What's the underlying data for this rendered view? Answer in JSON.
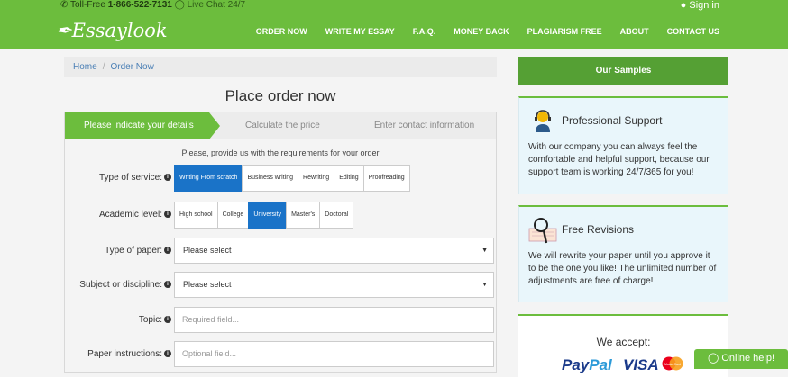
{
  "header": {
    "toll_free_label": "Toll-Free",
    "phone": "1-866-522-7131",
    "live_chat": "Live Chat 24/7",
    "sign_in": "Sign in",
    "logo": "Essaylook",
    "nav": [
      "ORDER NOW",
      "WRITE MY ESSAY",
      "F.A.Q.",
      "MONEY BACK",
      "PLAGIARISM FREE",
      "ABOUT",
      "CONTACT US"
    ]
  },
  "breadcrumb": {
    "home": "Home",
    "separator": "/",
    "current": "Order Now"
  },
  "page_title": "Place order now",
  "steps": [
    "Please indicate your details",
    "Calculate the price",
    "Enter contact information"
  ],
  "intro": "Please, provide us with the requirements for your order",
  "form": {
    "service": {
      "label": "Type of service:",
      "options": [
        "Writing From scratch",
        "Business writing",
        "Rewriting",
        "Editing",
        "Proofreading"
      ],
      "selected": "Writing From scratch"
    },
    "level": {
      "label": "Academic level:",
      "options": [
        "High school",
        "College",
        "University",
        "Master's",
        "Doctoral"
      ],
      "selected": "University"
    },
    "paper_type": {
      "label": "Type of paper:",
      "value": "Please select"
    },
    "subject": {
      "label": "Subject or discipline:",
      "value": "Please select"
    },
    "topic": {
      "label": "Topic:",
      "placeholder": "Required field..."
    },
    "instructions": {
      "label": "Paper instructions:",
      "placeholder": "Optional field..."
    }
  },
  "sidebar": {
    "samples": "Our Samples",
    "support": {
      "title": "Professional Support",
      "text": "With our company you can always feel the comfortable and helpful support, because our support team is working 24/7/365 for you!"
    },
    "revisions": {
      "title": "Free Revisions",
      "text": "We will rewrite your paper until you approve it to be the one you like! The unlimited number of adjustments are free of charge!"
    },
    "accept": {
      "title": "We accept:",
      "paypal_a": "Pay",
      "paypal_b": "Pal",
      "visa": "VISA",
      "mastercard": "MasterCard"
    }
  },
  "online_help": "Online help!",
  "colors": {
    "brand_green": "#6cbd3d",
    "active_blue": "#1a73c8",
    "card_bg": "#e9f6fb"
  }
}
